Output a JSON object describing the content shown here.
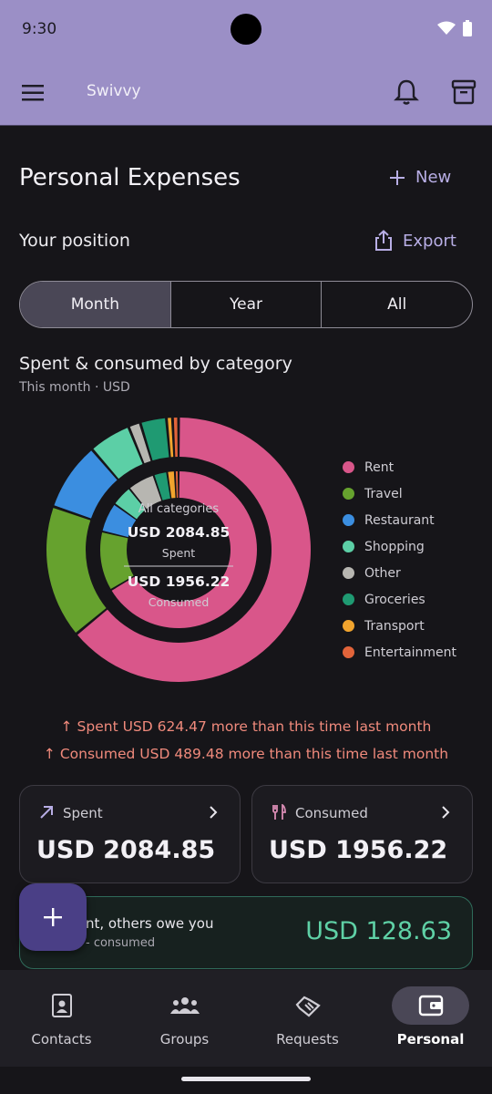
{
  "status_bar": {
    "time": "9:30"
  },
  "app_bar": {
    "title": "Swivvy"
  },
  "page": {
    "title": "Personal Expenses",
    "new_label": "New",
    "position_title": "Your position",
    "export_label": "Export",
    "segments": [
      {
        "label": "Month",
        "selected": true
      },
      {
        "label": "Year",
        "selected": false
      },
      {
        "label": "All",
        "selected": false
      }
    ]
  },
  "chart_section": {
    "title": "Spent & consumed by category",
    "subtitle": "This month · USD",
    "center": {
      "title": "All categories",
      "spent_amount": "USD 2084.85",
      "spent_label": "Spent",
      "consumed_amount": "USD 1956.22",
      "consumed_label": "Consumed"
    }
  },
  "chart_data": {
    "type": "donut",
    "rings": [
      {
        "ring": "outer",
        "total": 2084.85
      },
      {
        "ring": "inner",
        "total": 1956.22
      }
    ],
    "categories": [
      "Rent",
      "Travel",
      "Restaurant",
      "Shopping",
      "Other",
      "Groceries",
      "Transport",
      "Entertainment"
    ],
    "colors": [
      "#d9568a",
      "#66a22e",
      "#3b8ee0",
      "#5ccfa6",
      "#b7b6b1",
      "#1f9a72",
      "#f1a42e",
      "#e2643a"
    ],
    "series": [
      {
        "values": [
          1300,
          330,
          170,
          105,
          30,
          65,
          15,
          15
        ]
      },
      {
        "values": [
          1300,
          240,
          120,
          85,
          110,
          55,
          31,
          15
        ]
      }
    ]
  },
  "comparison": {
    "spent_text": "Spent USD 624.47 more than this time last month",
    "consumed_text": "Consumed USD 489.48 more than this time last month"
  },
  "cards": {
    "spent": {
      "label": "Spent",
      "amount": "USD 2084.85"
    },
    "consumed": {
      "label": "Consumed",
      "amount": "USD 1956.22"
    }
  },
  "owe_card": {
    "title": "nt, others owe you",
    "subtitle": "- consumed",
    "amount": "USD 128.63"
  },
  "bottom_nav": [
    {
      "label": "Contacts",
      "icon": "contact-icon",
      "selected": false
    },
    {
      "label": "Groups",
      "icon": "groups-icon",
      "selected": false
    },
    {
      "label": "Requests",
      "icon": "handshake-icon",
      "selected": false
    },
    {
      "label": "Personal",
      "icon": "wallet-icon",
      "selected": true
    }
  ],
  "colors": {
    "accent": "#9b8fc6",
    "link": "#b8aee5",
    "warning": "#f08a7c",
    "positive": "#5fd1a6",
    "fab": "#4a3f86"
  }
}
